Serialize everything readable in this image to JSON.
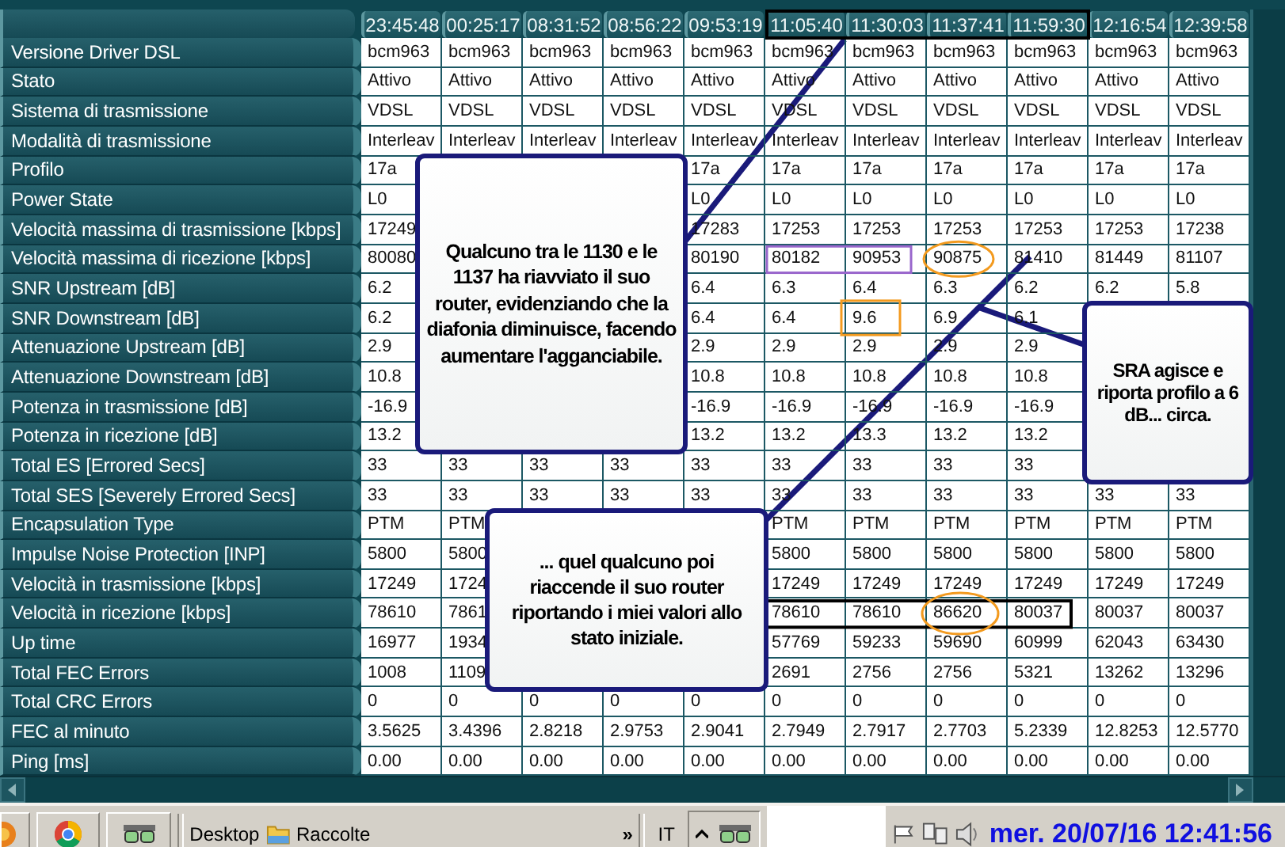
{
  "header": {
    "times": [
      "23:45:48",
      "00:25:17",
      "08:31:52",
      "08:56:22",
      "09:53:19",
      "11:05:40",
      "11:30:03",
      "11:37:41",
      "11:59:30",
      "12:16:54",
      "12:39:58"
    ]
  },
  "rows": [
    {
      "label": "Versione Driver DSL",
      "values": [
        "bcm963",
        "bcm963",
        "bcm963",
        "bcm963",
        "bcm963",
        "bcm963",
        "bcm963",
        "bcm963",
        "bcm963",
        "bcm963",
        "bcm963"
      ]
    },
    {
      "label": "Stato",
      "values": [
        "Attivo",
        "Attivo",
        "Attivo",
        "Attivo",
        "Attivo",
        "Attivo",
        "Attivo",
        "Attivo",
        "Attivo",
        "Attivo",
        "Attivo"
      ]
    },
    {
      "label": "Sistema di trasmissione",
      "values": [
        "VDSL",
        "VDSL",
        "VDSL",
        "VDSL",
        "VDSL",
        "VDSL",
        "VDSL",
        "VDSL",
        "VDSL",
        "VDSL",
        "VDSL"
      ]
    },
    {
      "label": "Modalità di trasmissione",
      "values": [
        "Interleav",
        "Interleav",
        "Interleav",
        "Interleav",
        "Interleav",
        "Interleav",
        "Interleav",
        "Interleav",
        "Interleav",
        "Interleav",
        "Interleav"
      ]
    },
    {
      "label": "Profilo",
      "values": [
        "17a",
        "17a",
        "17a",
        "17a",
        "17a",
        "17a",
        "17a",
        "17a"
      ]
    },
    {
      "label": "Power State",
      "values": [
        "L0",
        "L0",
        "L0",
        "L0",
        "L0",
        "L0",
        "L0",
        "L0"
      ]
    },
    {
      "label": "Velocità massima di trasmissione [kbps]",
      "values": [
        "17249",
        "17283",
        "17253",
        "17253",
        "17253",
        "17253",
        "17253",
        "17238"
      ]
    },
    {
      "label": "Velocità massima di ricezione [kbps]",
      "values": [
        "80080",
        "80190",
        "80182",
        "90953",
        "90875",
        "81410",
        "81449",
        "81107"
      ]
    },
    {
      "label": "SNR Upstream [dB]",
      "values": [
        "6.2",
        "6.4",
        "6.3",
        "6.4",
        "6.3",
        "6.2",
        "6.2",
        "5.8"
      ]
    },
    {
      "label": "SNR Downstream [dB]",
      "values": [
        "6.2",
        "6.4",
        "6.4",
        "9.6",
        "6.9",
        "6.1"
      ]
    },
    {
      "label": "Attenuazione Upstream [dB]",
      "values": [
        "2.9",
        "2.9",
        "2.9",
        "2.9",
        "2.9",
        "2.9"
      ]
    },
    {
      "label": "Attenuazione Downstream [dB]",
      "values": [
        "10.8",
        "10.8",
        "10.8",
        "10.8",
        "10.8",
        "10.8"
      ]
    },
    {
      "label": "Potenza in trasmissione [dB]",
      "values": [
        "-16.9",
        "-16.9",
        "-16.9",
        "-16.9",
        "-16.9",
        "-16.9"
      ]
    },
    {
      "label": "Potenza in ricezione [dB]",
      "values": [
        "13.2",
        "13.2",
        "13.2",
        "13.3",
        "13.2",
        "13.2"
      ]
    },
    {
      "label": "Total ES [Errored Secs]",
      "values": [
        "33",
        "33",
        "33",
        "33",
        "33",
        "33",
        "33",
        "33",
        "33"
      ]
    },
    {
      "label": "Total SES [Severely Errored Secs]",
      "values": [
        "33",
        "33",
        "33",
        "33",
        "33",
        "33",
        "33",
        "33",
        "33",
        "33",
        "33"
      ]
    },
    {
      "label": "Encapsulation Type",
      "values": [
        "PTM",
        "PTM",
        "PTM",
        "PTM",
        "PTM",
        "PTM",
        "PTM",
        "PTM"
      ]
    },
    {
      "label": "Impulse Noise Protection [INP]",
      "values": [
        "5800",
        "5800",
        "5800",
        "5800",
        "5800",
        "5800",
        "5800",
        "5800"
      ]
    },
    {
      "label": "Velocità in trasmissione [kbps]",
      "values": [
        "17249",
        "1724",
        "17249",
        "17249",
        "17249",
        "17249",
        "17249",
        "17249"
      ]
    },
    {
      "label": "Velocità in ricezione [kbps]",
      "values": [
        "78610",
        "7861",
        "78610",
        "78610",
        "86620",
        "80037",
        "80037",
        "80037"
      ]
    },
    {
      "label": "Up time",
      "values": [
        "16977",
        "1934",
        "57769",
        "59233",
        "59690",
        "60999",
        "62043",
        "63430"
      ]
    },
    {
      "label": "Total FEC Errors",
      "values": [
        "1008",
        "1109",
        "2691",
        "2756",
        "2756",
        "5321",
        "13262",
        "13296"
      ]
    },
    {
      "label": "Total CRC Errors",
      "values": [
        "0",
        "0",
        "0",
        "0",
        "0",
        "0",
        "0",
        "0",
        "0",
        "0",
        "0"
      ]
    },
    {
      "label": "FEC al minuto",
      "values": [
        "3.5625",
        "3.4396",
        "2.8218",
        "2.9753",
        "2.9041",
        "2.7949",
        "2.7917",
        "2.7703",
        "5.2339",
        "12.8253",
        "12.5770"
      ]
    },
    {
      "label": "Ping [ms]",
      "values": [
        "0.00",
        "0.00",
        "0.00",
        "0.00",
        "0.00",
        "0.00",
        "0.00",
        "0.00",
        "0.00",
        "0.00",
        "0.00"
      ]
    }
  ],
  "callouts": [
    {
      "text": "Qualcuno tra le 1130 e le 1137 ha riavviato il suo router, evidenziando che la diafonia diminuisce, facendo aumentare l'agganciabile."
    },
    {
      "text": "... quel qualcuno poi riaccende il suo router riportando i miei valori allo stato iniziale."
    },
    {
      "text": "SRA agisce e riporta profilo a 6 dB... circa."
    }
  ],
  "taskbar": {
    "toolbar_label": "Desktop",
    "folder": "Raccolte",
    "overflow": "»",
    "language": "IT",
    "clock": "mer. 20/07/16 12:41:56"
  }
}
